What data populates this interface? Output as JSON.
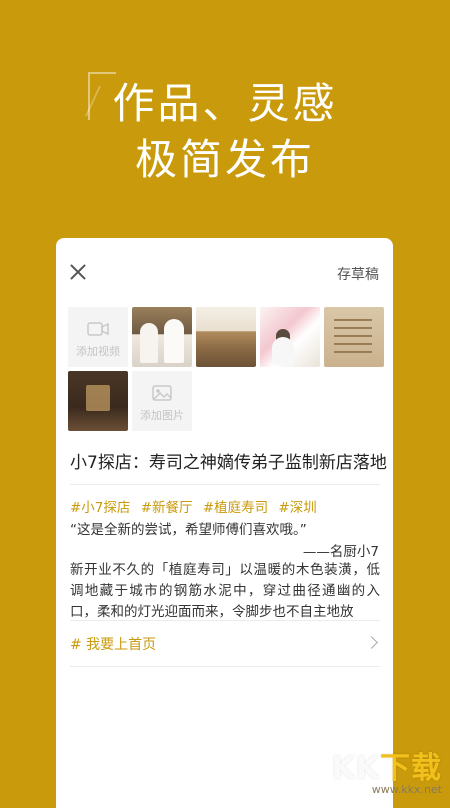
{
  "hero": {
    "line1": "作品、灵感",
    "line2": "极简发布"
  },
  "editor": {
    "draft_label": "存草稿",
    "add_video_label": "添加视频",
    "add_image_label": "添加图片",
    "post_title": "小7探店：寿司之神嫡传弟子监制新店落地",
    "tags": [
      "#小7探店",
      "#新餐厅",
      "#植庭寿司",
      "#深圳"
    ],
    "quote": "“这是全新的尝试，希望师傅们喜欢哦。”",
    "quote_author": "——名厨小7",
    "body": "新开业不久的「植庭寿司」以温暖的木色装潢，低调地藏于城市的钢筋水泥中，穿过曲径通幽的入口，柔和的灯光迎面而来，令脚步也不自主地放",
    "homepage_label": "# 我要上首页"
  },
  "watermark": {
    "brand_a": "KK",
    "brand_b": "下载",
    "url": "www.kkx.net"
  },
  "colors": {
    "accent": "#c99a0b",
    "card": "#ffffff"
  }
}
